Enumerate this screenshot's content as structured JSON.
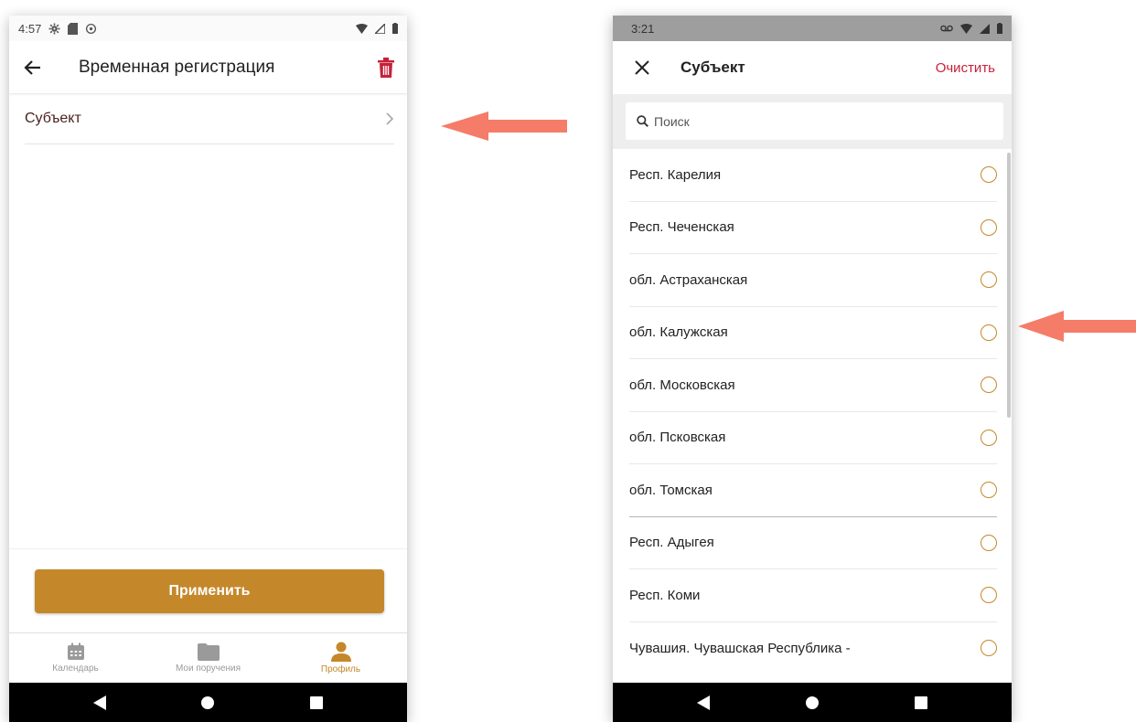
{
  "left_screen": {
    "status_bar": {
      "time": "4:57"
    },
    "app_bar": {
      "title": "Временная регистрация"
    },
    "subject_row": {
      "label": "Субъект"
    },
    "apply_button": {
      "label": "Применить"
    },
    "bottom_nav": [
      {
        "label": "Календарь",
        "icon": "calendar-icon",
        "active": false
      },
      {
        "label": "Мои поручения",
        "icon": "folder-icon",
        "active": false
      },
      {
        "label": "Профиль",
        "icon": "person-icon",
        "active": true
      }
    ]
  },
  "right_screen": {
    "status_bar": {
      "time": "3:21"
    },
    "app_bar": {
      "title": "Субъект",
      "clear_label": "Очистить"
    },
    "search": {
      "placeholder": "Поиск"
    },
    "items": [
      {
        "label": "Респ. Карелия"
      },
      {
        "label": "Респ. Чеченская"
      },
      {
        "label": "обл. Астраханская"
      },
      {
        "label": "обл. Калужская"
      },
      {
        "label": "обл. Московская"
      },
      {
        "label": "обл. Псковская"
      },
      {
        "label": "обл. Томская"
      },
      {
        "label": "Респ. Адыгея"
      },
      {
        "label": "Респ. Коми"
      },
      {
        "label": "Чувашия. Чувашская Республика -"
      }
    ]
  },
  "colors": {
    "accent": "#c4882b",
    "danger": "#c6203a",
    "annotation_arrow": "#f47c68"
  }
}
